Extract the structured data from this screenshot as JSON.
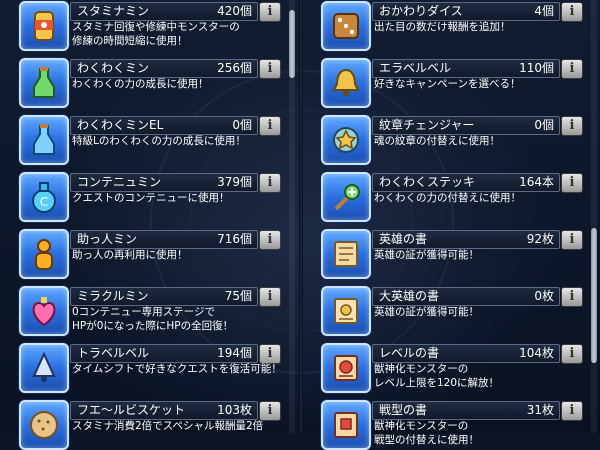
{
  "info_label": "i",
  "left_items": [
    {
      "name": "スタミナミン",
      "count": "420個",
      "desc": [
        "スタミナ回復や修練中モンスターの",
        "修練の時間短縮に使用！"
      ],
      "icon": "stamina-can-icon"
    },
    {
      "name": "わくわくミン",
      "count": "256個",
      "desc": [
        "わくわくの力の成長に使用！"
      ],
      "icon": "green-bottle-icon"
    },
    {
      "name": "わくわくミンEL",
      "count": "0個",
      "desc": [
        "特級Lのわくわくの力の成長に使用！"
      ],
      "icon": "blue-bottle-icon"
    },
    {
      "name": "コンテニュミン",
      "count": "379個",
      "desc": [
        "クエストのコンテニューに使用！"
      ],
      "icon": "continue-potion-icon"
    },
    {
      "name": "助っ人ミン",
      "count": "716個",
      "desc": [
        "助っ人の再利用に使用！"
      ],
      "icon": "helper-figure-icon"
    },
    {
      "name": "ミラクルミン",
      "count": "75個",
      "desc": [
        "0コンテニュー専用ステージで",
        "HPが0になった際にHPの全回復！"
      ],
      "icon": "heart-potion-icon"
    },
    {
      "name": "トラベルベル",
      "count": "194個",
      "desc": [
        "タイムシフトで好きなクエストを復活可能！"
      ],
      "icon": "travel-bell-icon"
    },
    {
      "name": "フエ〜ルビスケット",
      "count": "103枚",
      "desc": [
        "スタミナ消費2倍でスペシャル報酬量2倍"
      ],
      "icon": "biscuit-icon"
    }
  ],
  "right_items": [
    {
      "name": "おかわりダイス",
      "count": "4個",
      "desc": [
        "出た目の数だけ報酬を追加！"
      ],
      "icon": "dice-icon"
    },
    {
      "name": "エラベルベル",
      "count": "110個",
      "desc": [
        "好きなキャンペーンを選べる！"
      ],
      "icon": "gold-bell-icon"
    },
    {
      "name": "紋章チェンジャー",
      "count": "0個",
      "desc": [
        "魂の紋章の付替えに使用！"
      ],
      "icon": "crest-changer-icon"
    },
    {
      "name": "わくわくステッキ",
      "count": "164本",
      "desc": [
        "わくわくの力の付替えに使用！"
      ],
      "icon": "magic-wand-icon"
    },
    {
      "name": "英雄の書",
      "count": "92枚",
      "desc": [
        "英雄の証が獲得可能！"
      ],
      "icon": "hero-book-icon"
    },
    {
      "name": "大英雄の書",
      "count": "0枚",
      "desc": [
        "英雄の証が獲得可能！"
      ],
      "icon": "great-hero-book-icon"
    },
    {
      "name": "レベルの書",
      "count": "104枚",
      "desc": [
        "獣神化モンスターの",
        "レベル上限を120に解放！"
      ],
      "icon": "level-book-icon"
    },
    {
      "name": "戦型の書",
      "count": "31枚",
      "desc": [
        "獣神化モンスターの",
        "戦型の付替えに使用！"
      ],
      "icon": "battle-book-icon"
    }
  ]
}
